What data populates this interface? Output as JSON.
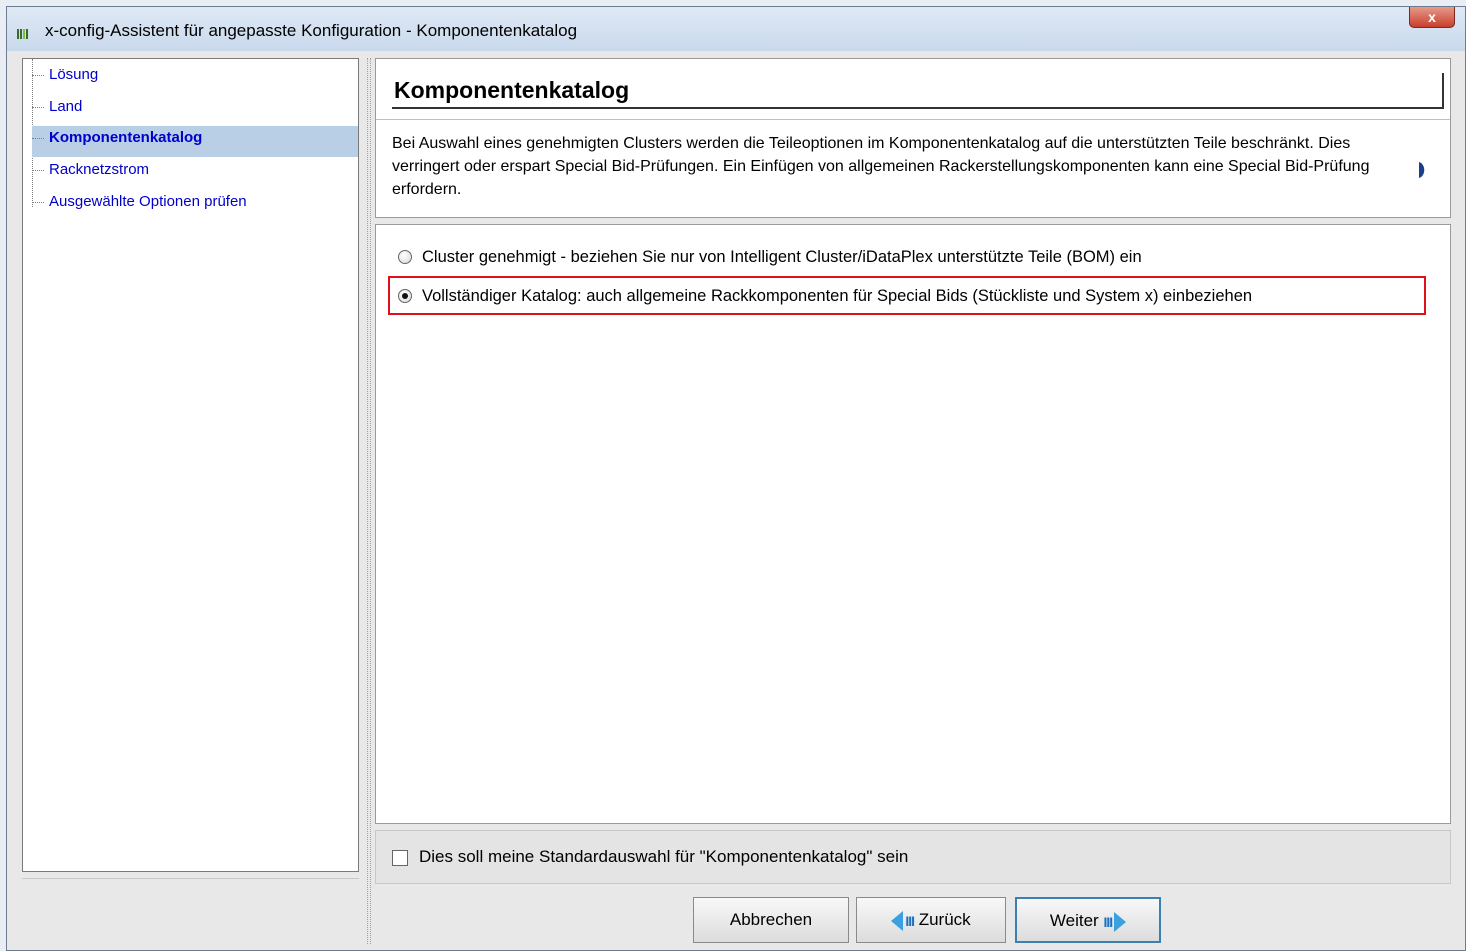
{
  "window": {
    "title": "x-config-Assistent für angepasste Konfiguration - Komponentenkatalog",
    "close_label": "x"
  },
  "sidebar": {
    "items": [
      {
        "label": "Lösung",
        "selected": false
      },
      {
        "label": "Land",
        "selected": false
      },
      {
        "label": "Komponentenkatalog",
        "selected": true
      },
      {
        "label": "Racknetzstrom",
        "selected": false
      },
      {
        "label": "Ausgewählte Optionen prüfen",
        "selected": false
      }
    ]
  },
  "main": {
    "title": "Komponentenkatalog",
    "description": "Bei Auswahl eines genehmigten Clusters werden die Teileoptionen im Komponentenkatalog auf die unterstützten Teile beschränkt. Dies verringert oder erspart Special Bid-Prüfungen. Ein Einfügen von allgemeinen Rackerstellungskomponenten kann eine Special Bid-Prüfung erfordern.",
    "options": [
      {
        "label": "Cluster genehmigt - beziehen Sie nur von Intelligent Cluster/iDataPlex unterstützte Teile (BOM) ein",
        "selected": false
      },
      {
        "label": "Vollständiger Katalog: auch allgemeine Rackkomponenten für Special Bids (Stückliste und System x) einbeziehen",
        "selected": true
      }
    ],
    "default_checkbox_label": "Dies soll meine Standardauswahl für \"Komponentenkatalog\" sein",
    "default_checked": false
  },
  "buttons": {
    "cancel": "Abbrechen",
    "back": "Zurück",
    "next": "Weiter"
  },
  "colors": {
    "highlight": "#e0101a",
    "selection": "#b8cfe5",
    "link": "#0000cc"
  }
}
